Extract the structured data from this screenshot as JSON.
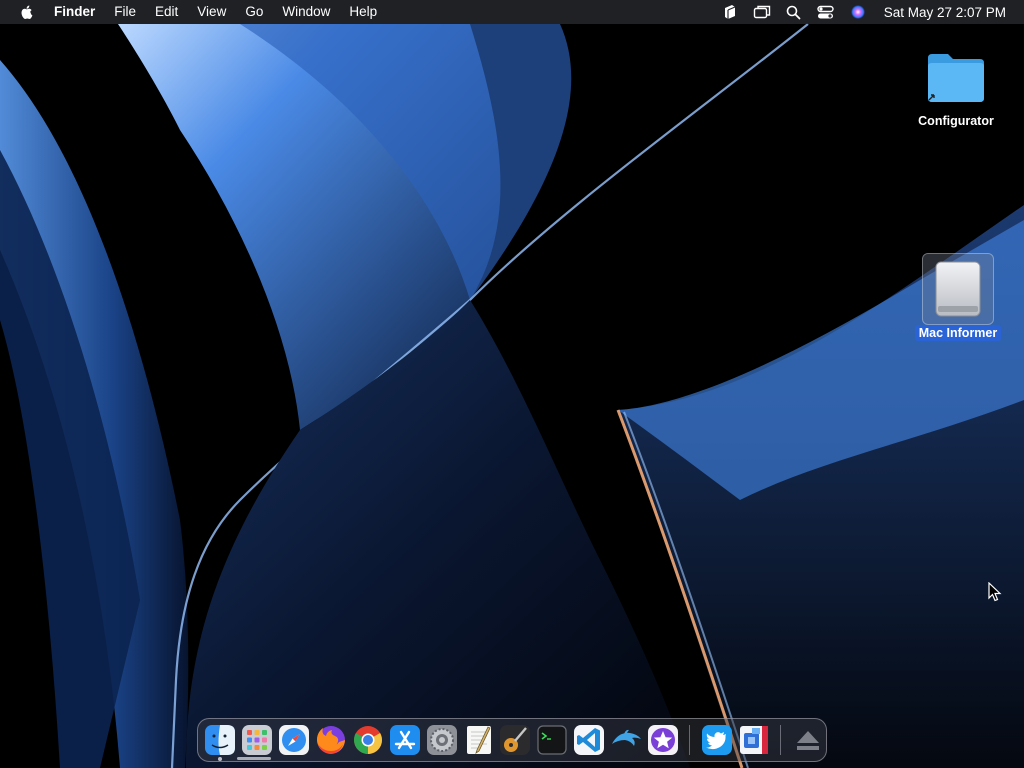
{
  "menubar": {
    "app_name": "Finder",
    "items": [
      "File",
      "Edit",
      "View",
      "Go",
      "Window",
      "Help"
    ],
    "status_icons": [
      "stack-icon",
      "screen-mirror-icon",
      "spotlight-search-icon",
      "control-center-icon",
      "siri-icon"
    ],
    "clock": "Sat May 27  2:07 PM"
  },
  "desktop": {
    "icons": [
      {
        "label": "Configurator",
        "icon": "folder-alias-icon",
        "selected": false
      },
      {
        "label": "Mac Informer",
        "icon": "external-drive-icon",
        "selected": true
      }
    ]
  },
  "dock": {
    "apps": [
      {
        "name": "Finder",
        "icon": "finder-icon",
        "running": true
      },
      {
        "name": "Launchpad",
        "icon": "launchpad-icon",
        "running": false
      },
      {
        "name": "Safari",
        "icon": "safari-icon",
        "running": false
      },
      {
        "name": "Firefox",
        "icon": "firefox-icon",
        "running": false
      },
      {
        "name": "Google Chrome",
        "icon": "chrome-icon",
        "running": false
      },
      {
        "name": "App Store",
        "icon": "app-store-icon",
        "running": false
      },
      {
        "name": "System Settings",
        "icon": "system-settings-icon",
        "running": false
      },
      {
        "name": "TextEdit",
        "icon": "textedit-icon",
        "running": false
      },
      {
        "name": "GarageBand",
        "icon": "garageband-icon",
        "running": false
      },
      {
        "name": "Terminal",
        "icon": "terminal-icon",
        "running": false
      },
      {
        "name": "Visual Studio Code",
        "icon": "vscode-icon",
        "running": false
      },
      {
        "name": "Dolphin",
        "icon": "dolphin-icon",
        "running": false
      },
      {
        "name": "iMovie",
        "icon": "imovie-icon",
        "running": false
      }
    ],
    "recent": [
      {
        "name": "Twitter",
        "icon": "twitter-icon"
      },
      {
        "name": "Mac Informer",
        "icon": "mac-informer-icon"
      }
    ],
    "trash": {
      "name": "Eject",
      "icon": "eject-icon"
    }
  },
  "colors": {
    "accent": "#2a63d6",
    "menubar": "#282a30",
    "wallpaper_blue": "#3f7fdc"
  }
}
